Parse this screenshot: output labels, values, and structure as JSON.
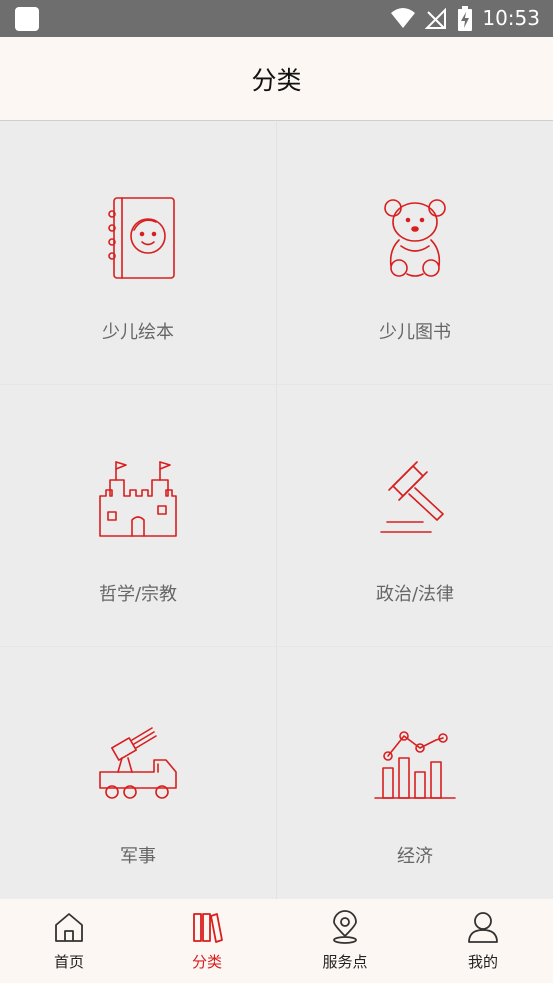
{
  "status_bar": {
    "time": "10:53"
  },
  "header": {
    "title": "分类"
  },
  "categories": [
    {
      "label": "少儿绘本",
      "icon": "child-book-icon"
    },
    {
      "label": "少儿图书",
      "icon": "teddy-bear-icon"
    },
    {
      "label": "哲学/宗教",
      "icon": "castle-icon"
    },
    {
      "label": "政治/法律",
      "icon": "gavel-icon"
    },
    {
      "label": "军事",
      "icon": "rocket-truck-icon"
    },
    {
      "label": "经济",
      "icon": "bar-chart-icon"
    }
  ],
  "tabs": [
    {
      "label": "首页",
      "icon": "home-icon",
      "active": false
    },
    {
      "label": "分类",
      "icon": "books-icon",
      "active": true
    },
    {
      "label": "服务点",
      "icon": "location-pin-icon",
      "active": false
    },
    {
      "label": "我的",
      "icon": "user-icon",
      "active": false
    }
  ],
  "colors": {
    "accent": "#d81e1e",
    "header_bg": "#fcf7f2",
    "grid_bg": "#ececec"
  }
}
